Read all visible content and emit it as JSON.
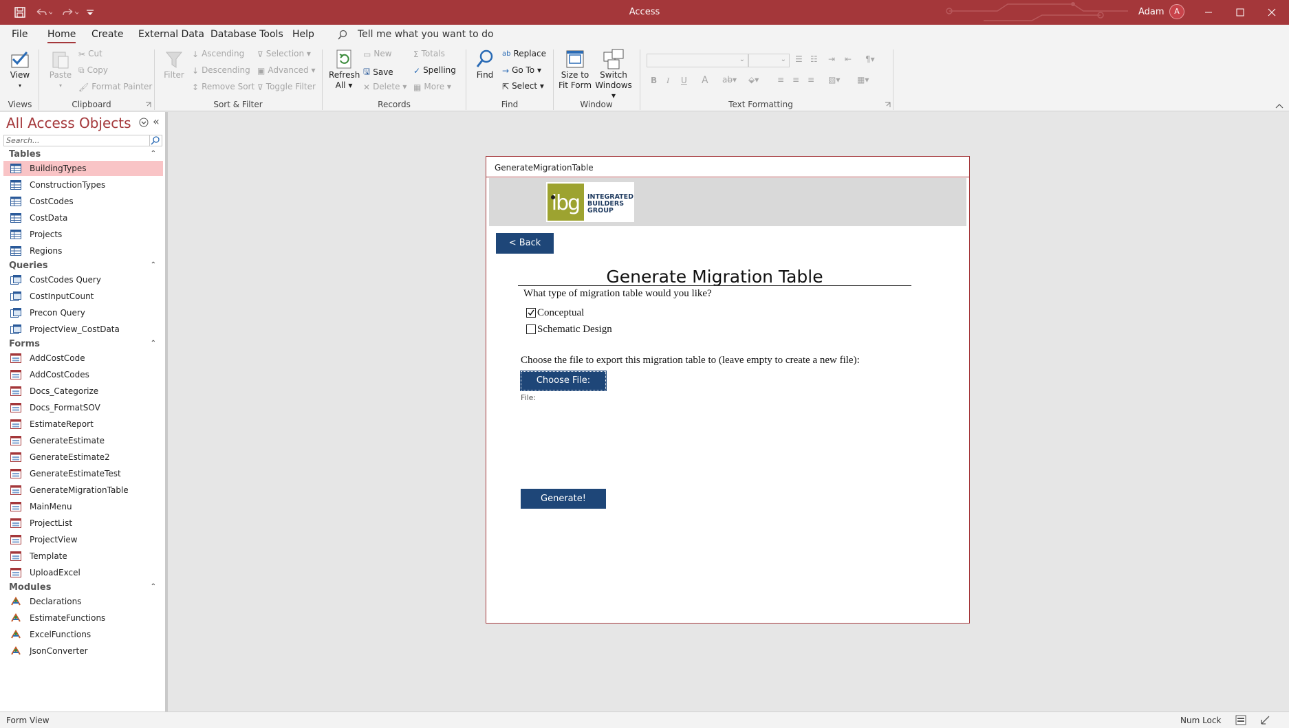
{
  "app": {
    "title": "Access",
    "user": "Adam",
    "avatar_initial": "A"
  },
  "menu": {
    "tabs": [
      "File",
      "Home",
      "Create",
      "External Data",
      "Database Tools",
      "Help"
    ],
    "tell_me": "Tell me what you want to do"
  },
  "ribbon": {
    "views": {
      "view": "View",
      "label": "Views"
    },
    "clipboard": {
      "paste": "Paste",
      "cut": "Cut",
      "copy": "Copy",
      "format_painter": "Format Painter",
      "label": "Clipboard"
    },
    "sort_filter": {
      "filter": "Filter",
      "ascending": "Ascending",
      "descending": "Descending",
      "remove_sort": "Remove Sort",
      "selection": "Selection",
      "advanced": "Advanced",
      "toggle_filter": "Toggle Filter",
      "label": "Sort & Filter"
    },
    "records": {
      "refresh_1": "Refresh",
      "refresh_2": "All",
      "new": "New",
      "save": "Save",
      "delete": "Delete",
      "totals": "Totals",
      "spelling": "Spelling",
      "more": "More",
      "label": "Records"
    },
    "find": {
      "find": "Find",
      "replace": "Replace",
      "go_to": "Go To",
      "select": "Select",
      "label": "Find"
    },
    "window": {
      "size_1": "Size to",
      "size_2": "Fit Form",
      "switch_1": "Switch",
      "switch_2": "Windows",
      "label": "Window"
    },
    "text_formatting": {
      "bold": "B",
      "italic": "I",
      "underline": "U",
      "font_color": "A",
      "label": "Text Formatting"
    }
  },
  "nav": {
    "title": "All Access Objects",
    "search_placeholder": "Search...",
    "sections": {
      "tables": {
        "label": "Tables",
        "items": [
          "BuildingTypes",
          "ConstructionTypes",
          "CostCodes",
          "CostData",
          "Projects",
          "Regions"
        ]
      },
      "queries": {
        "label": "Queries",
        "items": [
          "CostCodes Query",
          "CostInputCount",
          "Precon Query",
          "ProjectView_CostData"
        ]
      },
      "forms": {
        "label": "Forms",
        "items": [
          "AddCostCode",
          "AddCostCodes",
          "Docs_Categorize",
          "Docs_FormatSOV",
          "EstimateReport",
          "GenerateEstimate",
          "GenerateEstimate2",
          "GenerateEstimateTest",
          "GenerateMigrationTable",
          "MainMenu",
          "ProjectList",
          "ProjectView",
          "Template",
          "UploadExcel"
        ]
      },
      "modules": {
        "label": "Modules",
        "items": [
          "Declarations",
          "EstimateFunctions",
          "ExcelFunctions",
          "JsonConverter"
        ]
      }
    }
  },
  "form": {
    "tab_title": "GenerateMigrationTable",
    "logo_lines": [
      "INTEGRATED",
      "BUILDERS",
      "GROUP"
    ],
    "back_label": "< Back",
    "heading": "Generate Migration Table",
    "question": "What type of migration table would you like?",
    "options": [
      {
        "label": "Conceptual",
        "checked": true
      },
      {
        "label": "Schematic Design",
        "checked": false
      }
    ],
    "file_prompt": "Choose the file to export this migration table to (leave empty to create a new file):",
    "choose_file_label": "Choose File:",
    "file_label": "File:",
    "generate_label": "Generate!"
  },
  "status": {
    "left": "Form View",
    "num_lock": "Num Lock"
  },
  "colors": {
    "accent": "#a4373a",
    "button": "#1e4678",
    "selected_row": "#f9c4c6",
    "logo_green": "#9da330"
  }
}
